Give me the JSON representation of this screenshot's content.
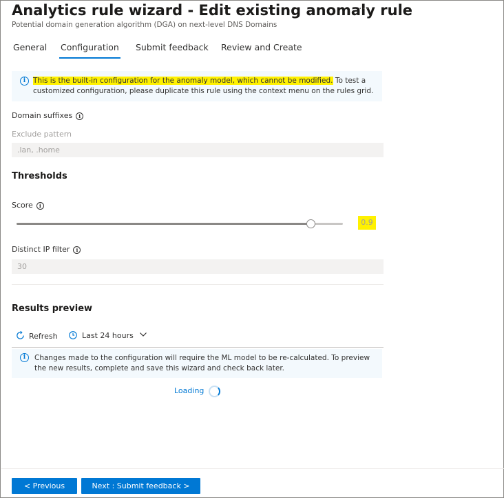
{
  "header": {
    "title": "Analytics rule wizard - Edit existing anomaly rule",
    "more": "···",
    "subtitle": "Potential domain generation algorithm (DGA) on next-level DNS Domains"
  },
  "tabs": [
    {
      "label": "General"
    },
    {
      "label": "Configuration",
      "active": true
    },
    {
      "label": "Submit feedback"
    },
    {
      "label": "Review and Create"
    }
  ],
  "notice": {
    "icon": "info-icon",
    "highlighted": "This is the built-in configuration for the anomaly model, which cannot be modified.",
    "rest_line1": " To test a",
    "line2": "customized configuration, please duplicate this rule using the context menu on the rules grid."
  },
  "domain_suffixes": {
    "label": "Domain suffixes",
    "exclude_label": "Exclude pattern",
    "exclude_placeholder": ".lan, .home"
  },
  "thresholds": {
    "heading": "Thresholds",
    "score_label": "Score",
    "score_value": "0.9",
    "score_fraction": 0.9,
    "distinct_ip_label": "Distinct IP filter",
    "distinct_ip_value": "30"
  },
  "results": {
    "heading": "Results preview",
    "refresh_label": "Refresh",
    "time_range_label": "Last 24 hours",
    "notice_line1": "Changes made to the configuration will require the ML model to be re-calculated. To preview",
    "notice_line2": "the new results, complete and save this wizard and check back later.",
    "loading_label": "Loading"
  },
  "footer": {
    "previous_label": "< Previous",
    "next_label": "Next : Submit feedback >"
  },
  "colors": {
    "accent": "#0078d4",
    "highlight": "#fff100",
    "info_background": "#f3f9fd"
  }
}
